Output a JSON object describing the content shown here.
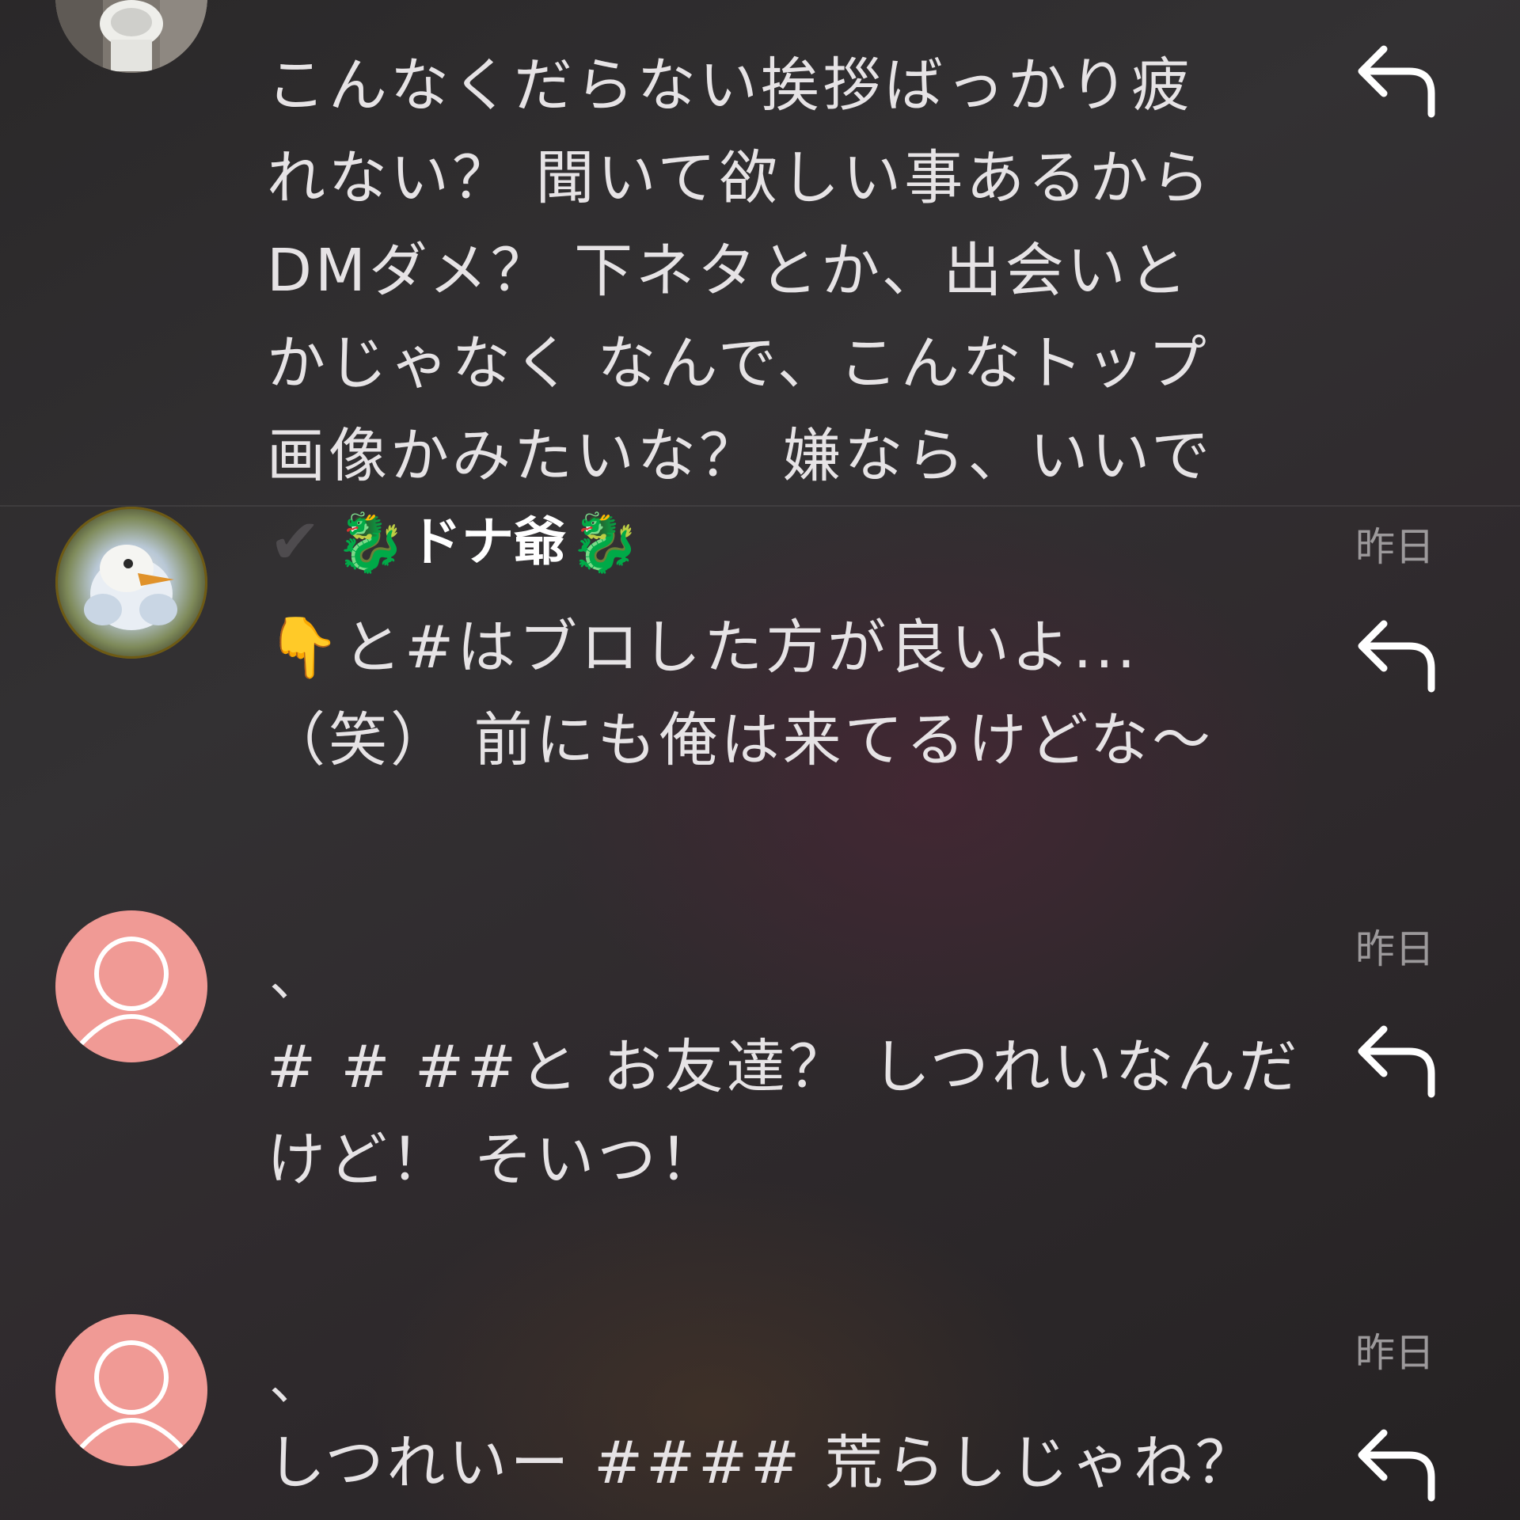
{
  "comments": [
    {
      "avatar": "toilet-photo-avatar",
      "text": "こんなくだらない挨拶ばっかり疲\nれない？ 聞いて欲しい事あるから\nDMダメ？ 下ネタとか、出会いと\nかじゃなく なんで、こんなトップ\n画像かみたいな？ 嫌なら、いいで",
      "reply_icon": "reply-arrow-icon"
    },
    {
      "avatar": "duck-character-avatar",
      "verified_icon": "✔",
      "deco_left": "🐉",
      "name": "ドナ爺",
      "deco_right": "🐉",
      "date": "昨日",
      "emoji": "👇",
      "text_after_emoji": "と#はブロした方が良いよ...\n（笑） 前にも俺は来てるけどな～",
      "reply_icon": "reply-arrow-icon"
    },
    {
      "avatar": "default-user-avatar",
      "name": "、",
      "date": "昨日",
      "text": "# # ##と お友達？ しつれいなんだ\nけど！ そいつ！",
      "reply_icon": "reply-arrow-icon"
    },
    {
      "avatar": "default-user-avatar",
      "name": "、",
      "date": "昨日",
      "text": "しつれいー #### 荒らしじゃね？",
      "reply_icon": "reply-arrow-icon"
    }
  ],
  "colors": {
    "default_avatar_bg": "#f09a95",
    "text": "#e6e3e5",
    "date": "#9c999b"
  }
}
